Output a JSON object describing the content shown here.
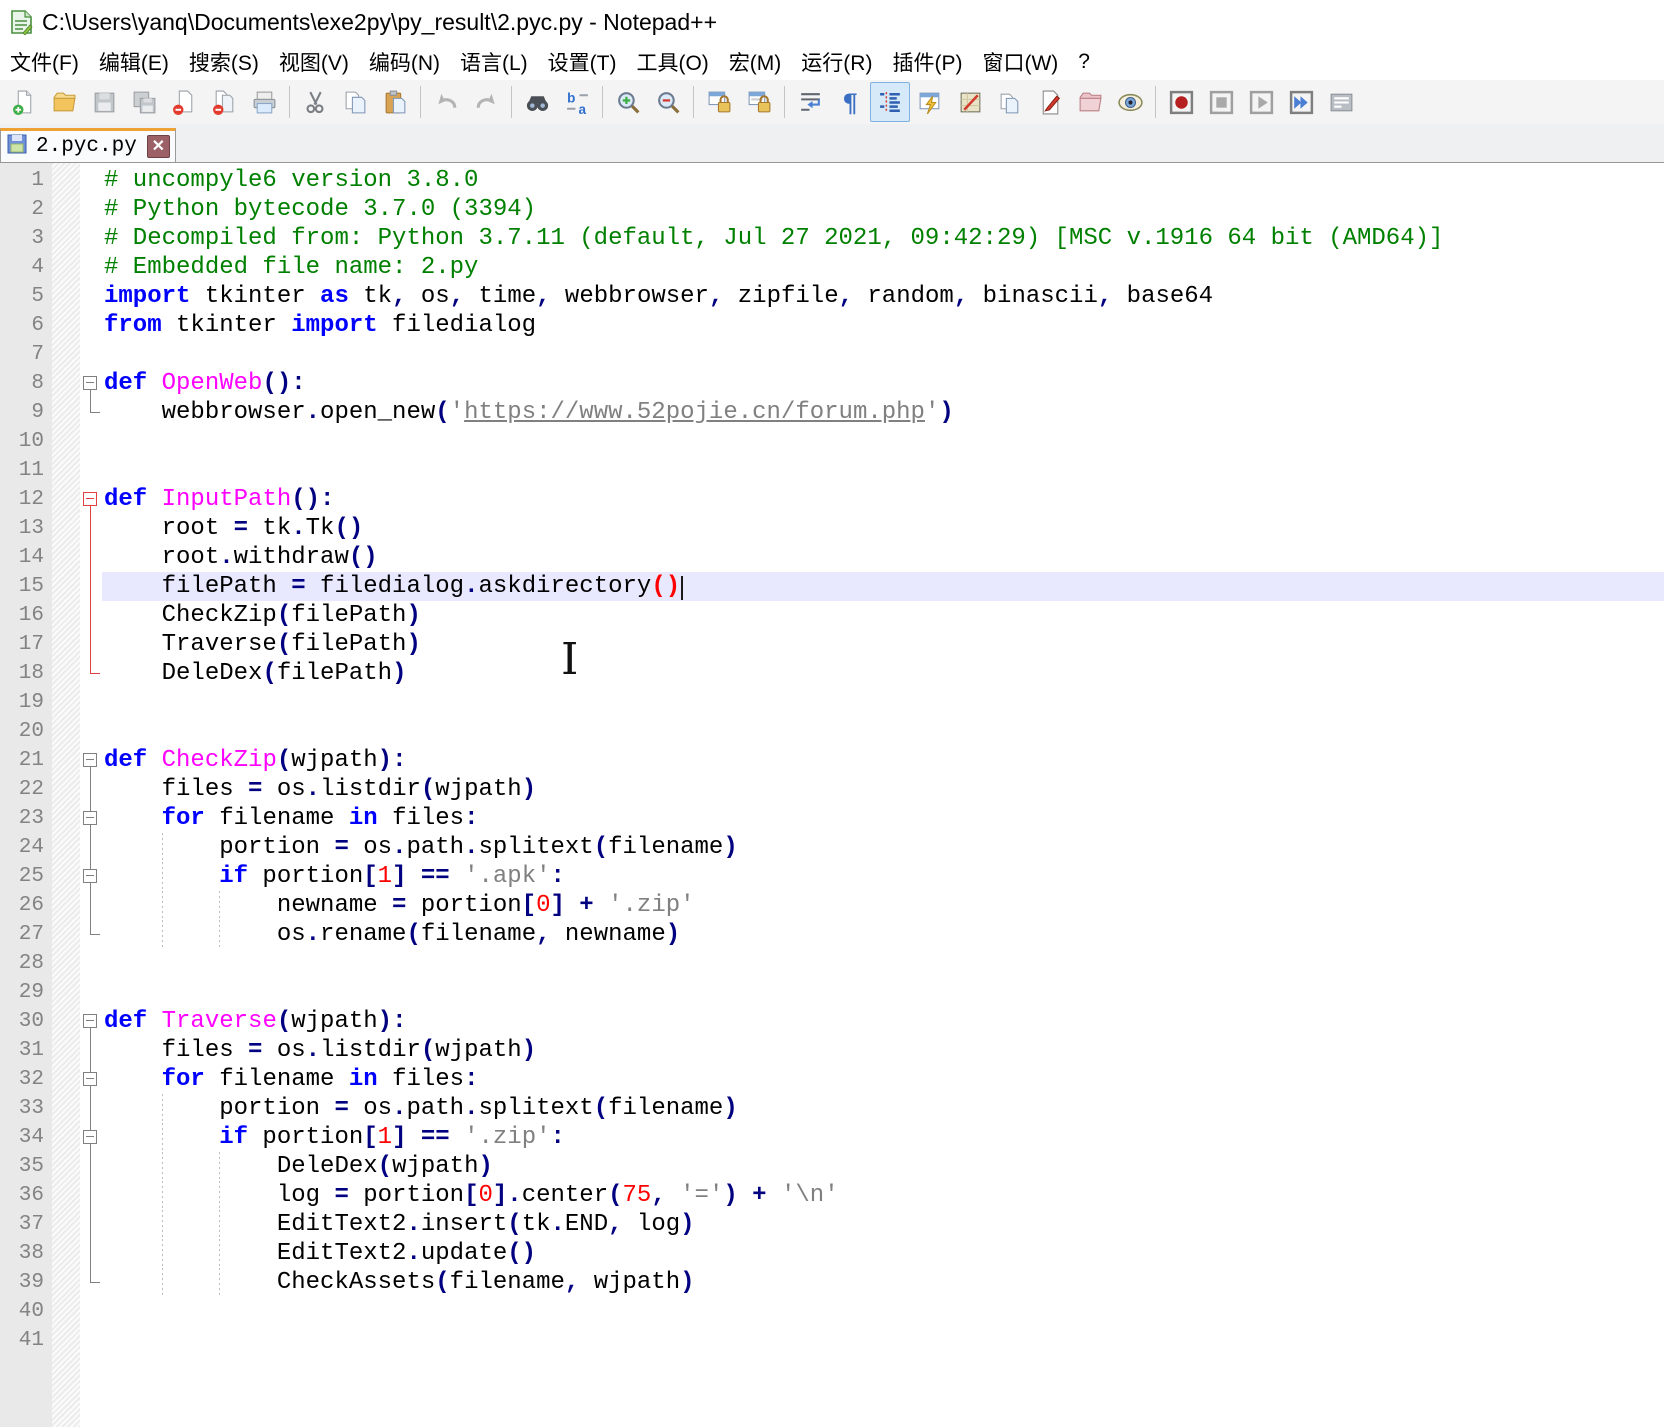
{
  "window": {
    "title": "C:\\Users\\yanq\\Documents\\exe2py\\py_result\\2.pyc.py - Notepad++"
  },
  "menu": {
    "items": [
      "文件(F)",
      "编辑(E)",
      "搜索(S)",
      "视图(V)",
      "编码(N)",
      "语言(L)",
      "设置(T)",
      "工具(O)",
      "宏(M)",
      "运行(R)",
      "插件(P)",
      "窗口(W)",
      "?"
    ]
  },
  "toolbar": {
    "groups": [
      [
        "new-file",
        "open-folder",
        "save",
        "save-all",
        "close",
        "close-all",
        "print"
      ],
      [
        "cut",
        "copy",
        "paste"
      ],
      [
        "undo",
        "redo"
      ],
      [
        "find",
        "replace"
      ],
      [
        "zoom-in",
        "zoom-out"
      ],
      [
        "sync-vertical-scroll",
        "sync-horizontal-scroll"
      ],
      [
        "word-wrap",
        "show-all-characters",
        "show-indent-guide",
        "function-completion",
        "document-map",
        "clone-document",
        "edit-marker",
        "folder-as-workspace",
        "monitoring-eye"
      ],
      [
        "macro-record",
        "macro-stop",
        "macro-play",
        "macro-run-multiple",
        "macro-save"
      ]
    ],
    "active": [
      "show-indent-guide"
    ],
    "disabled": [
      "save",
      "save-all",
      "undo",
      "redo"
    ]
  },
  "tabbar": {
    "tabs": [
      {
        "label": "2.pyc.py",
        "active": true,
        "saved": true
      }
    ]
  },
  "editor": {
    "colors": {
      "comment": "#008000",
      "keyword": "#0000ff",
      "function": "#ff00ff",
      "operator": "#000080",
      "number": "#ff0000",
      "string": "#808080",
      "current_line": "#e8e8ff",
      "brace_match": "#ff0000",
      "fold_active": "#e04040"
    },
    "lines": [
      {
        "n": 1,
        "segs": [
          [
            "c",
            "# uncompyle6 version 3.8.0"
          ]
        ]
      },
      {
        "n": 2,
        "segs": [
          [
            "c",
            "# Python bytecode 3.7.0 (3394)"
          ]
        ]
      },
      {
        "n": 3,
        "segs": [
          [
            "c",
            "# Decompiled from: Python 3.7.11 (default, Jul 27 2021, 09:42:29) [MSC v.1916 64 bit (AMD64)]"
          ]
        ]
      },
      {
        "n": 4,
        "segs": [
          [
            "c",
            "# Embedded file name: 2.py"
          ]
        ]
      },
      {
        "n": 5,
        "segs": [
          [
            "k",
            "import"
          ],
          [
            "t",
            " tkinter "
          ],
          [
            "k",
            "as"
          ],
          [
            "t",
            " tk"
          ],
          [
            "o",
            ","
          ],
          [
            "t",
            " os"
          ],
          [
            "o",
            ","
          ],
          [
            "t",
            " time"
          ],
          [
            "o",
            ","
          ],
          [
            "t",
            " webbrowser"
          ],
          [
            "o",
            ","
          ],
          [
            "t",
            " zipfile"
          ],
          [
            "o",
            ","
          ],
          [
            "t",
            " random"
          ],
          [
            "o",
            ","
          ],
          [
            "t",
            " binascii"
          ],
          [
            "o",
            ","
          ],
          [
            "t",
            " base64"
          ]
        ]
      },
      {
        "n": 6,
        "segs": [
          [
            "k",
            "from"
          ],
          [
            "t",
            " tkinter "
          ],
          [
            "k",
            "import"
          ],
          [
            "t",
            " filedialog"
          ]
        ]
      },
      {
        "n": 7,
        "segs": []
      },
      {
        "n": 8,
        "fold": "b",
        "segs": [
          [
            "k",
            "def"
          ],
          [
            "t",
            " "
          ],
          [
            "f",
            "OpenWeb"
          ],
          [
            "o",
            "():"
          ]
        ]
      },
      {
        "n": 9,
        "fold": "e",
        "segs": [
          [
            "t",
            "    webbrowser"
          ],
          [
            "o",
            "."
          ],
          [
            "t",
            "open_new"
          ],
          [
            "o",
            "("
          ],
          [
            "s",
            "'"
          ],
          [
            "u",
            "https://www.52pojie.cn/forum.php"
          ],
          [
            "s",
            "'"
          ],
          [
            "o",
            ")"
          ]
        ]
      },
      {
        "n": 10,
        "segs": []
      },
      {
        "n": 11,
        "segs": []
      },
      {
        "n": 12,
        "fold": "b",
        "red": 1,
        "segs": [
          [
            "k",
            "def"
          ],
          [
            "t",
            " "
          ],
          [
            "f",
            "InputPath"
          ],
          [
            "o",
            "():"
          ]
        ]
      },
      {
        "n": 13,
        "fold": "v",
        "red": 1,
        "segs": [
          [
            "t",
            "    root "
          ],
          [
            "o",
            "="
          ],
          [
            "t",
            " tk"
          ],
          [
            "o",
            "."
          ],
          [
            "t",
            "Tk"
          ],
          [
            "o",
            "()"
          ]
        ]
      },
      {
        "n": 14,
        "fold": "v",
        "red": 1,
        "segs": [
          [
            "t",
            "    root"
          ],
          [
            "o",
            "."
          ],
          [
            "t",
            "withdraw"
          ],
          [
            "o",
            "()"
          ]
        ]
      },
      {
        "n": 15,
        "fold": "v",
        "red": 1,
        "hl": 1,
        "caret": 1,
        "segs": [
          [
            "t",
            "    filePath "
          ],
          [
            "o",
            "="
          ],
          [
            "t",
            " filedialog"
          ],
          [
            "o",
            "."
          ],
          [
            "t",
            "askdirectory"
          ],
          [
            "b",
            "()"
          ]
        ]
      },
      {
        "n": 16,
        "fold": "v",
        "red": 1,
        "segs": [
          [
            "t",
            "    CheckZip"
          ],
          [
            "o",
            "("
          ],
          [
            "t",
            "filePath"
          ],
          [
            "o",
            ")"
          ]
        ]
      },
      {
        "n": 17,
        "fold": "v",
        "red": 1,
        "segs": [
          [
            "t",
            "    Traverse"
          ],
          [
            "o",
            "("
          ],
          [
            "t",
            "filePath"
          ],
          [
            "o",
            ")"
          ]
        ]
      },
      {
        "n": 18,
        "fold": "e",
        "red": 1,
        "segs": [
          [
            "t",
            "    DeleDex"
          ],
          [
            "o",
            "("
          ],
          [
            "t",
            "filePath"
          ],
          [
            "o",
            ")"
          ]
        ]
      },
      {
        "n": 19,
        "segs": []
      },
      {
        "n": 20,
        "segs": []
      },
      {
        "n": 21,
        "fold": "b",
        "segs": [
          [
            "k",
            "def"
          ],
          [
            "t",
            " "
          ],
          [
            "f",
            "CheckZip"
          ],
          [
            "o",
            "("
          ],
          [
            "t",
            "wjpath"
          ],
          [
            "o",
            "):"
          ]
        ]
      },
      {
        "n": 22,
        "fold": "v",
        "segs": [
          [
            "t",
            "    files "
          ],
          [
            "o",
            "="
          ],
          [
            "t",
            " os"
          ],
          [
            "o",
            "."
          ],
          [
            "t",
            "listdir"
          ],
          [
            "o",
            "("
          ],
          [
            "t",
            "wjpath"
          ],
          [
            "o",
            ")"
          ]
        ]
      },
      {
        "n": 23,
        "fold": "bl",
        "segs": [
          [
            "t",
            "    "
          ],
          [
            "k",
            "for"
          ],
          [
            "t",
            " filename "
          ],
          [
            "k",
            "in"
          ],
          [
            "t",
            " files"
          ],
          [
            "o",
            ":"
          ]
        ]
      },
      {
        "n": 24,
        "fold": "v",
        "segs": [
          [
            "t",
            "        portion "
          ],
          [
            "o",
            "="
          ],
          [
            "t",
            " os"
          ],
          [
            "o",
            "."
          ],
          [
            "t",
            "path"
          ],
          [
            "o",
            "."
          ],
          [
            "t",
            "splitext"
          ],
          [
            "o",
            "("
          ],
          [
            "t",
            "filename"
          ],
          [
            "o",
            ")"
          ]
        ]
      },
      {
        "n": 25,
        "fold": "bl",
        "segs": [
          [
            "t",
            "        "
          ],
          [
            "k",
            "if"
          ],
          [
            "t",
            " portion"
          ],
          [
            "o",
            "["
          ],
          [
            "n",
            "1"
          ],
          [
            "o",
            "]"
          ],
          [
            "t",
            " "
          ],
          [
            "o",
            "=="
          ],
          [
            "t",
            " "
          ],
          [
            "s",
            "'.apk'"
          ],
          [
            "o",
            ":"
          ]
        ]
      },
      {
        "n": 26,
        "fold": "v",
        "segs": [
          [
            "t",
            "            newname "
          ],
          [
            "o",
            "="
          ],
          [
            "t",
            " portion"
          ],
          [
            "o",
            "["
          ],
          [
            "n",
            "0"
          ],
          [
            "o",
            "]"
          ],
          [
            "t",
            " "
          ],
          [
            "o",
            "+"
          ],
          [
            "t",
            " "
          ],
          [
            "s",
            "'.zip'"
          ]
        ]
      },
      {
        "n": 27,
        "fold": "e",
        "segs": [
          [
            "t",
            "            os"
          ],
          [
            "o",
            "."
          ],
          [
            "t",
            "rename"
          ],
          [
            "o",
            "("
          ],
          [
            "t",
            "filename"
          ],
          [
            "o",
            ","
          ],
          [
            "t",
            " newname"
          ],
          [
            "o",
            ")"
          ]
        ]
      },
      {
        "n": 28,
        "segs": []
      },
      {
        "n": 29,
        "segs": []
      },
      {
        "n": 30,
        "fold": "b",
        "segs": [
          [
            "k",
            "def"
          ],
          [
            "t",
            " "
          ],
          [
            "f",
            "Traverse"
          ],
          [
            "o",
            "("
          ],
          [
            "t",
            "wjpath"
          ],
          [
            "o",
            "):"
          ]
        ]
      },
      {
        "n": 31,
        "fold": "v",
        "segs": [
          [
            "t",
            "    files "
          ],
          [
            "o",
            "="
          ],
          [
            "t",
            " os"
          ],
          [
            "o",
            "."
          ],
          [
            "t",
            "listdir"
          ],
          [
            "o",
            "("
          ],
          [
            "t",
            "wjpath"
          ],
          [
            "o",
            ")"
          ]
        ]
      },
      {
        "n": 32,
        "fold": "bl",
        "segs": [
          [
            "t",
            "    "
          ],
          [
            "k",
            "for"
          ],
          [
            "t",
            " filename "
          ],
          [
            "k",
            "in"
          ],
          [
            "t",
            " files"
          ],
          [
            "o",
            ":"
          ]
        ]
      },
      {
        "n": 33,
        "fold": "v",
        "segs": [
          [
            "t",
            "        portion "
          ],
          [
            "o",
            "="
          ],
          [
            "t",
            " os"
          ],
          [
            "o",
            "."
          ],
          [
            "t",
            "path"
          ],
          [
            "o",
            "."
          ],
          [
            "t",
            "splitext"
          ],
          [
            "o",
            "("
          ],
          [
            "t",
            "filename"
          ],
          [
            "o",
            ")"
          ]
        ]
      },
      {
        "n": 34,
        "fold": "bl",
        "segs": [
          [
            "t",
            "        "
          ],
          [
            "k",
            "if"
          ],
          [
            "t",
            " portion"
          ],
          [
            "o",
            "["
          ],
          [
            "n",
            "1"
          ],
          [
            "o",
            "]"
          ],
          [
            "t",
            " "
          ],
          [
            "o",
            "=="
          ],
          [
            "t",
            " "
          ],
          [
            "s",
            "'.zip'"
          ],
          [
            "o",
            ":"
          ]
        ]
      },
      {
        "n": 35,
        "fold": "v",
        "segs": [
          [
            "t",
            "            DeleDex"
          ],
          [
            "o",
            "("
          ],
          [
            "t",
            "wjpath"
          ],
          [
            "o",
            ")"
          ]
        ]
      },
      {
        "n": 36,
        "fold": "v",
        "segs": [
          [
            "t",
            "            log "
          ],
          [
            "o",
            "="
          ],
          [
            "t",
            " portion"
          ],
          [
            "o",
            "["
          ],
          [
            "n",
            "0"
          ],
          [
            "o",
            "]"
          ],
          [
            "o",
            "."
          ],
          [
            "t",
            "center"
          ],
          [
            "o",
            "("
          ],
          [
            "n",
            "75"
          ],
          [
            "o",
            ","
          ],
          [
            "t",
            " "
          ],
          [
            "s",
            "'='"
          ],
          [
            "o",
            ")"
          ],
          [
            "t",
            " "
          ],
          [
            "o",
            "+"
          ],
          [
            "t",
            " "
          ],
          [
            "s",
            "'\\n'"
          ]
        ]
      },
      {
        "n": 37,
        "fold": "v",
        "segs": [
          [
            "t",
            "            EditText2"
          ],
          [
            "o",
            "."
          ],
          [
            "t",
            "insert"
          ],
          [
            "o",
            "("
          ],
          [
            "t",
            "tk"
          ],
          [
            "o",
            "."
          ],
          [
            "t",
            "END"
          ],
          [
            "o",
            ","
          ],
          [
            "t",
            " log"
          ],
          [
            "o",
            ")"
          ]
        ]
      },
      {
        "n": 38,
        "fold": "v",
        "segs": [
          [
            "t",
            "            EditText2"
          ],
          [
            "o",
            "."
          ],
          [
            "t",
            "update"
          ],
          [
            "o",
            "()"
          ]
        ]
      },
      {
        "n": 39,
        "fold": "e",
        "segs": [
          [
            "t",
            "            CheckAssets"
          ],
          [
            "o",
            "("
          ],
          [
            "t",
            "filename"
          ],
          [
            "o",
            ","
          ],
          [
            "t",
            " wjpath"
          ],
          [
            "o",
            ")"
          ]
        ]
      },
      {
        "n": 40,
        "segs": []
      },
      {
        "n": 41,
        "segs": []
      }
    ]
  }
}
